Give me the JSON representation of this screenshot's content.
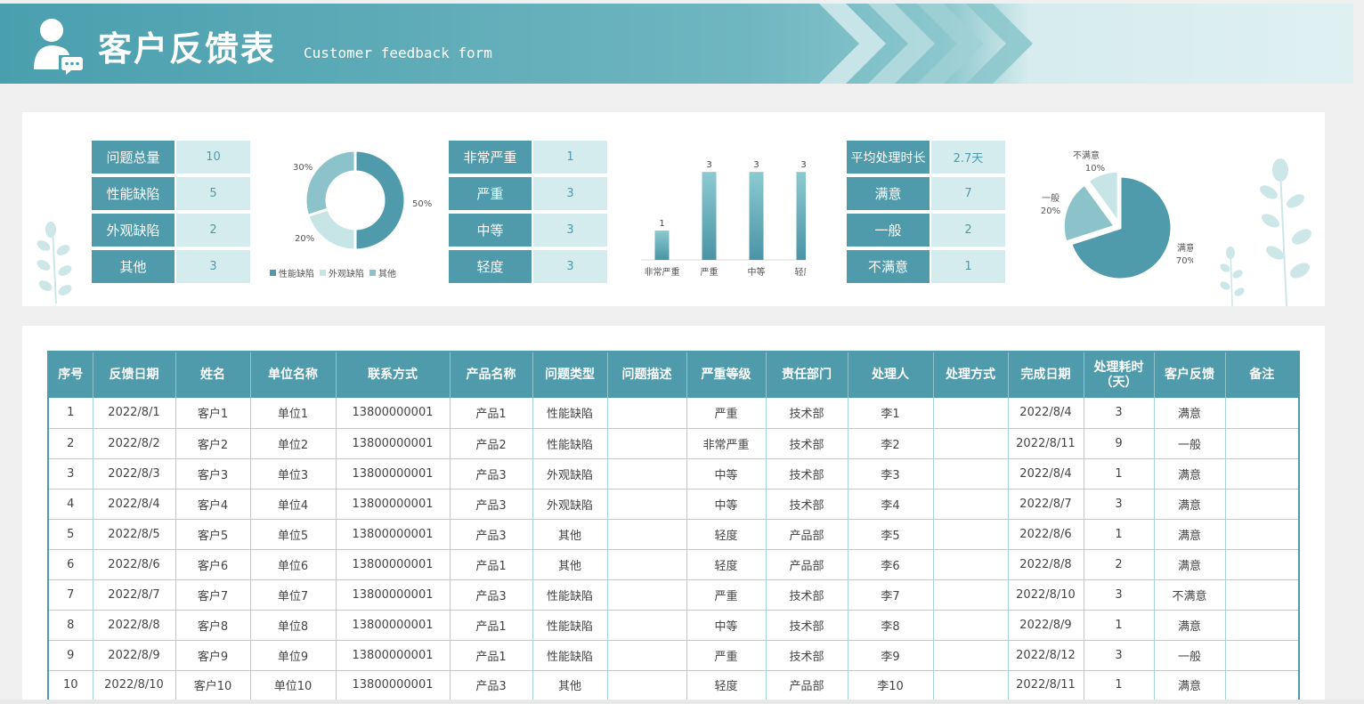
{
  "header": {
    "title": "客户反馈表",
    "subtitle": "Customer feedback form"
  },
  "summary": {
    "problem_types": [
      {
        "label": "问题总量",
        "value": "10"
      },
      {
        "label": "性能缺陷",
        "value": "5"
      },
      {
        "label": "外观缺陷",
        "value": "2"
      },
      {
        "label": "其他",
        "value": "3"
      }
    ],
    "severity": [
      {
        "label": "非常严重",
        "value": "1"
      },
      {
        "label": "严重",
        "value": "3"
      },
      {
        "label": "中等",
        "value": "3"
      },
      {
        "label": "轻度",
        "value": "3"
      }
    ],
    "satisfaction": [
      {
        "label": "平均处理时长",
        "value": "2.7天"
      },
      {
        "label": "满意",
        "value": "7"
      },
      {
        "label": "一般",
        "value": "2"
      },
      {
        "label": "不满意",
        "value": "1"
      }
    ]
  },
  "chart_data": [
    {
      "type": "pie",
      "categories": [
        "性能缺陷",
        "外观缺陷",
        "其他"
      ],
      "values": [
        50,
        20,
        30
      ],
      "value_labels": [
        "50%",
        "20%",
        "30%"
      ],
      "colors": [
        "#4f9aab",
        "#c7e4e7",
        "#8cc3ca"
      ],
      "legend": "bottom"
    },
    {
      "type": "bar",
      "categories": [
        "非常严重",
        "严重",
        "中等",
        "轻度"
      ],
      "values": [
        1,
        3,
        3,
        3
      ],
      "value_labels": [
        "1",
        "3",
        "3",
        "3"
      ],
      "ylim": [
        0,
        3.4
      ],
      "grid": false,
      "colors": [
        "#4f9aab"
      ]
    },
    {
      "type": "pie",
      "categories": [
        "满意",
        "一般",
        "不满意"
      ],
      "values": [
        70,
        20,
        10
      ],
      "value_labels": [
        "70%",
        "20%",
        "10%"
      ],
      "colors": [
        "#4f9aab",
        "#8cc3ca",
        "#c7e4e7"
      ]
    }
  ],
  "table": {
    "headers": [
      "序号",
      "反馈日期",
      "姓名",
      "单位名称",
      "联系方式",
      "产品名称",
      "问题类型",
      "问题描述",
      "严重等级",
      "责任部门",
      "处理人",
      "处理方式",
      "完成日期",
      "处理耗时\n（天）",
      "客户反馈",
      "备注"
    ],
    "rows": [
      [
        "1",
        "2022/8/1",
        "客户1",
        "单位1",
        "13800000001",
        "产品1",
        "性能缺陷",
        "",
        "严重",
        "技术部",
        "李1",
        "",
        "2022/8/4",
        "3",
        "满意",
        ""
      ],
      [
        "2",
        "2022/8/2",
        "客户2",
        "单位2",
        "13800000001",
        "产品2",
        "性能缺陷",
        "",
        "非常严重",
        "技术部",
        "李2",
        "",
        "2022/8/11",
        "9",
        "一般",
        ""
      ],
      [
        "3",
        "2022/8/3",
        "客户3",
        "单位3",
        "13800000001",
        "产品3",
        "外观缺陷",
        "",
        "中等",
        "技术部",
        "李3",
        "",
        "2022/8/4",
        "1",
        "满意",
        ""
      ],
      [
        "4",
        "2022/8/4",
        "客户4",
        "单位4",
        "13800000001",
        "产品3",
        "外观缺陷",
        "",
        "中等",
        "技术部",
        "李4",
        "",
        "2022/8/7",
        "3",
        "满意",
        ""
      ],
      [
        "5",
        "2022/8/5",
        "客户5",
        "单位5",
        "13800000001",
        "产品3",
        "其他",
        "",
        "轻度",
        "产品部",
        "李5",
        "",
        "2022/8/6",
        "1",
        "满意",
        ""
      ],
      [
        "6",
        "2022/8/6",
        "客户6",
        "单位6",
        "13800000001",
        "产品1",
        "其他",
        "",
        "轻度",
        "产品部",
        "李6",
        "",
        "2022/8/8",
        "2",
        "满意",
        ""
      ],
      [
        "7",
        "2022/8/7",
        "客户7",
        "单位7",
        "13800000001",
        "产品3",
        "性能缺陷",
        "",
        "严重",
        "技术部",
        "李7",
        "",
        "2022/8/10",
        "3",
        "不满意",
        ""
      ],
      [
        "8",
        "2022/8/8",
        "客户8",
        "单位8",
        "13800000001",
        "产品1",
        "性能缺陷",
        "",
        "中等",
        "技术部",
        "李8",
        "",
        "2022/8/9",
        "1",
        "满意",
        ""
      ],
      [
        "9",
        "2022/8/9",
        "客户9",
        "单位9",
        "13800000001",
        "产品1",
        "性能缺陷",
        "",
        "严重",
        "技术部",
        "李9",
        "",
        "2022/8/12",
        "3",
        "一般",
        ""
      ],
      [
        "10",
        "2022/8/10",
        "客户10",
        "单位10",
        "13800000001",
        "产品3",
        "其他",
        "",
        "轻度",
        "产品部",
        "李10",
        "",
        "2022/8/11",
        "1",
        "满意",
        ""
      ]
    ]
  }
}
